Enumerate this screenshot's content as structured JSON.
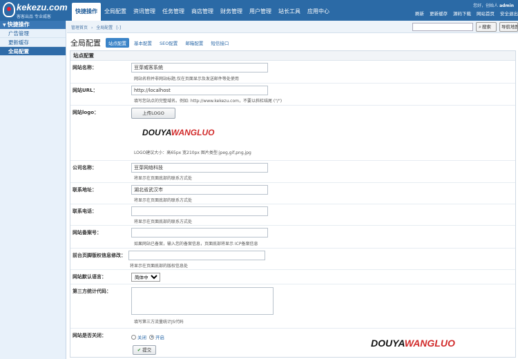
{
  "brand": {
    "logo_text": "kekezu.com",
    "slogan": "客客出品 专业威客"
  },
  "topnav": {
    "items": [
      "快捷操作",
      "全局配置",
      "资讯管理",
      "任务管理",
      "商店管理",
      "财务管理",
      "用户管理",
      "站长工具",
      "应用中心"
    ]
  },
  "user": {
    "greeting": "您好，创始人",
    "name": "admin"
  },
  "toplinks": [
    "刷新",
    "更新缓存",
    "源码下载",
    "网站首页",
    "安全退出"
  ],
  "sidebar": {
    "title": "快捷操作",
    "items": [
      "广告管理",
      "更新缓存",
      "全局配置"
    ]
  },
  "breadcrumb": [
    "管理首页",
    "全局配置",
    "[-]"
  ],
  "search": {
    "button": "搜索",
    "map_button": "导航地图"
  },
  "page": {
    "title": "全局配置",
    "tabs": [
      "站点配置",
      "基本配置",
      "SEO配置",
      "邮箱配置",
      "短信接口"
    ]
  },
  "section": {
    "title": "站点配置"
  },
  "form": {
    "site_name": {
      "label": "网站名称：",
      "value": "豆芽威客系统",
      "hint": "网站名称并非网站标题,仅在页面显示及发送邮件等处使用"
    },
    "site_url": {
      "label": "网站URL：",
      "value": "http://localhost",
      "hint": "填写您站点的完整域名。例如: http://www.kekezu.com，不要以斜杠结尾 (\"/\")"
    },
    "site_logo": {
      "label": "网站logo：",
      "button": "上传LOGO",
      "logo_a": "DOUYA",
      "logo_b": "WANGLUO",
      "hint": "LOGO建议大小：高65px 宽210px 图片类型:jpeg,gif,png,jpg"
    },
    "company": {
      "label": "公司名称：",
      "value": "豆芽网络科技",
      "hint": "将显示在页面底部的联系方式处"
    },
    "address": {
      "label": "联系地址：",
      "value": "湖北省武汉市",
      "hint": "将显示在页面底部的联系方式处"
    },
    "phone": {
      "label": "联系电话：",
      "value": "",
      "hint": "将显示在页面底部的联系方式处"
    },
    "icp": {
      "label": "网站备案号：",
      "value": "",
      "hint": "如果网站已备案，输入您的备案信息，页面底部将显示 ICP备案信息"
    },
    "footer_copy": {
      "label": "前台页脚版权信息修改：",
      "value": "",
      "hint": "将显示在页面底部的版权信息处"
    },
    "language": {
      "label": "网站默认语言：",
      "selected": "简体中文"
    },
    "stats_code": {
      "label": "第三方统计代码：",
      "hint": "填写第三方流量统计JS代码"
    },
    "close_site": {
      "label": "网站是否关闭：",
      "option_off": "关闭",
      "option_on": "开启",
      "selected": "开启"
    },
    "submit": "提交"
  },
  "watermark": {
    "a": "DOUYA",
    "b": "WANGLUO"
  },
  "colors": {
    "topbar": "#2b6aa6",
    "accent": "#3b84c8",
    "brand_red": "#d12b2b"
  }
}
